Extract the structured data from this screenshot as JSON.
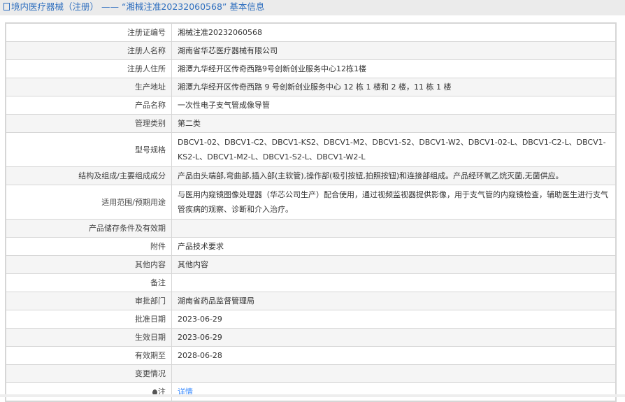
{
  "header": {
    "title": "境内医疗器械（注册） —— “湘械注准20232060568” 基本信息"
  },
  "rows": [
    {
      "label": "注册证编号",
      "value": "湘械注准20232060568"
    },
    {
      "label": "注册人名称",
      "value": "湖南省华芯医疗器械有限公司"
    },
    {
      "label": "注册人住所",
      "value": "湘潭九华经开区传奇西路9号创新创业服务中心12栋1楼"
    },
    {
      "label": "生产地址",
      "value": "湘潭九华经开区传奇西路 9 号创新创业服务中心 12 栋 1 楼和 2 楼，11 栋 1 楼"
    },
    {
      "label": "产品名称",
      "value": "一次性电子支气管成像导管"
    },
    {
      "label": "管理类别",
      "value": "第二类"
    },
    {
      "label": "型号规格",
      "value": "DBCV1-02、DBCV1-C2、DBCV1-KS2、DBCV1-M2、DBCV1-S2、DBCV1-W2、DBCV1-02-L、DBCV1-C2-L、DBCV1-KS2-L、DBCV1-M2-L、DBCV1-S2-L、DBCV1-W2-L"
    },
    {
      "label": "结构及组成/主要组成成分",
      "value": "产品由头端部,弯曲部,插入部(主软管),操作部(吸引按钮,拍照按钮)和连接部组成。产品经环氧乙烷灭菌,无菌供应。"
    },
    {
      "label": "适用范围/预期用途",
      "value": "与医用内窥镜图像处理器（华芯公司生产）配合使用，通过视频监视器提供影像，用于支气管的内窥镜检查，辅助医生进行支气管疾病的观察、诊断和介入治疗。"
    },
    {
      "label": "产品储存条件及有效期",
      "value": ""
    },
    {
      "label": "附件",
      "value": "产品技术要求"
    },
    {
      "label": "其他内容",
      "value": "其他内容"
    },
    {
      "label": "备注",
      "value": ""
    },
    {
      "label": "审批部门",
      "value": "湖南省药品监督管理局"
    },
    {
      "label": "批准日期",
      "value": "2023-06-29"
    },
    {
      "label": "生效日期",
      "value": "2023-06-29"
    },
    {
      "label": "有效期至",
      "value": "2028-06-28"
    },
    {
      "label": "变更情况",
      "value": ""
    }
  ],
  "note": {
    "label": "注",
    "link": "详情"
  }
}
